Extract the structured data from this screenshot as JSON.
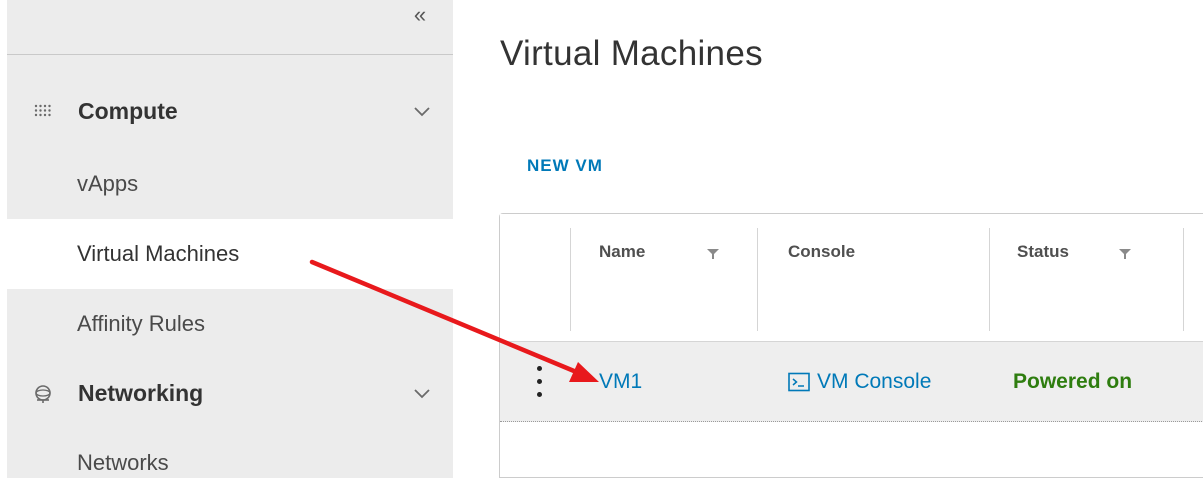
{
  "sidebar": {
    "collapse_glyph": "«",
    "groups": [
      {
        "label": "Compute",
        "icon": "grid-dots-icon",
        "items": [
          {
            "label": "vApps",
            "active": false
          },
          {
            "label": "Virtual Machines",
            "active": true
          },
          {
            "label": "Affinity Rules",
            "active": false
          }
        ]
      },
      {
        "label": "Networking",
        "icon": "globe-network-icon",
        "items": [
          {
            "label": "Networks",
            "active": false
          }
        ]
      }
    ]
  },
  "main": {
    "title": "Virtual Machines",
    "new_vm_label": "NEW VM",
    "table": {
      "columns": [
        "Name",
        "Console",
        "Status"
      ],
      "rows": [
        {
          "name": "VM1",
          "console": "VM Console",
          "status": "Powered on"
        }
      ]
    }
  },
  "colors": {
    "link": "#0079b8",
    "status_on": "#2e7d0f",
    "annotation_arrow": "#e8191c",
    "sidebar_bg": "#ececec"
  }
}
